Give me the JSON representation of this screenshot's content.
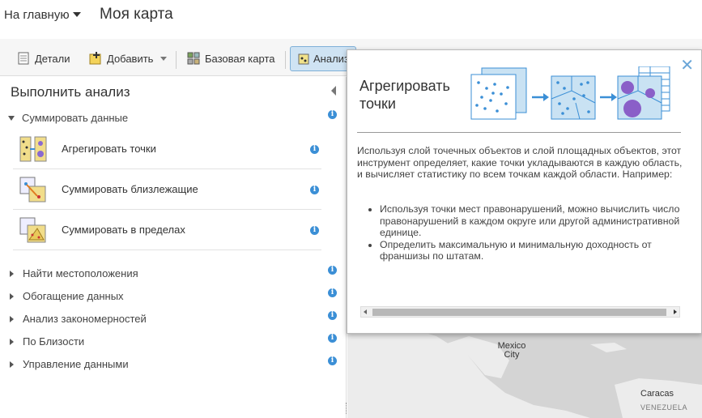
{
  "header": {
    "home_label": "На главную",
    "map_title": "Моя карта"
  },
  "toolbar": {
    "details": "Детали",
    "add": "Добавить",
    "basemap": "Базовая карта",
    "analysis": "Анализ"
  },
  "panel": {
    "title": "Выполнить анализ",
    "expanded_group": "Суммировать данные",
    "tools": [
      {
        "label": "Агрегировать точки"
      },
      {
        "label": "Суммировать близлежащие"
      },
      {
        "label": "Суммировать в пределах"
      }
    ],
    "groups": [
      {
        "label": "Найти местоположения"
      },
      {
        "label": "Обогащение данных"
      },
      {
        "label": "Анализ закономерностей"
      },
      {
        "label": "По Близости"
      },
      {
        "label": "Управление данными"
      }
    ]
  },
  "popup": {
    "title_line1": "Агрегировать",
    "title_line2": "точки",
    "close": "✕",
    "description": "Используя слой точечных объектов и слой площадных объектов, этот инструмент определяет, какие точки укладываются в каждую область, и вычисляет статистику по всем точкам каждой области. Например:",
    "examples": [
      "Используя точки мест правонарушений, можно вычислить число правонарушений в каждом округе или другой административной единице.",
      "Определить максимальную и минимальную доходность от франшизы по штатам."
    ]
  },
  "map": {
    "cities": [
      {
        "name": "Mexico City"
      },
      {
        "name": "Caracas"
      }
    ],
    "countries": [
      {
        "name": "VENEZUELA"
      }
    ]
  },
  "colors": {
    "accent": "#3b8fd6",
    "popup_bg": "#ffffff",
    "map_land": "#ececec",
    "map_water": "#d4d4d4"
  }
}
